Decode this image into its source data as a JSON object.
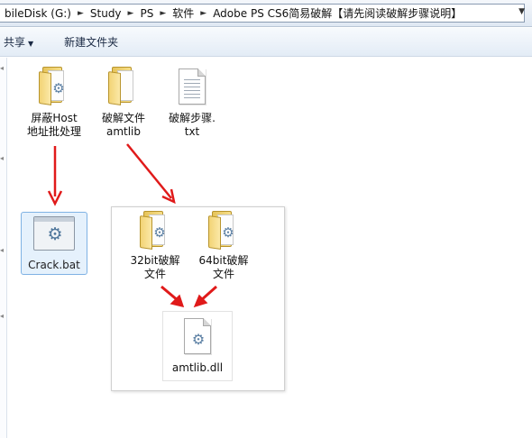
{
  "address_bar": {
    "crumbs": [
      "bileDisk (G:)",
      "Study",
      "PS",
      "软件",
      "Adobe PS CS6简易破解【请先阅读破解步骤说明】"
    ],
    "separator": "►",
    "dropdown": "▼"
  },
  "toolbar": {
    "share_label": "共享",
    "share_arrow": "▼",
    "new_folder_label": "新建文件夹"
  },
  "files": [
    {
      "line1": "屏蔽Host",
      "line2": "地址批处理",
      "icon": "folder-gear-icon"
    },
    {
      "line1": "破解文件",
      "line2": "amtlib",
      "icon": "folder-icon"
    },
    {
      "line1": "破解步骤.",
      "line2": "txt",
      "icon": "text-file-icon"
    }
  ],
  "selected_file": {
    "label": "Crack.bat",
    "icon": "batch-gear-icon"
  },
  "panel": {
    "folders": [
      {
        "line1": "32bit破解",
        "line2": "文件",
        "icon": "folder-gear-icon"
      },
      {
        "line1": "64bit破解",
        "line2": "文件",
        "icon": "folder-gear-icon"
      }
    ],
    "dll": {
      "label": "amtlib.dll",
      "icon": "dll-gear-icon"
    }
  },
  "colors": {
    "arrow": "#e01a1a",
    "selection_fill": "#e5f1fc",
    "selection_border": "#7fb2e4"
  }
}
